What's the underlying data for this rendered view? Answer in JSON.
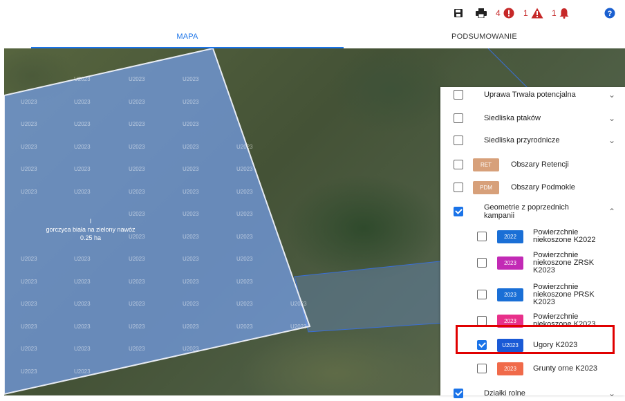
{
  "toolbar": {
    "save_icon": "save-icon",
    "print_icon": "print-icon",
    "errors_count": "4",
    "warnings_count": "1",
    "notifications_count": "1",
    "help_icon": "help-icon"
  },
  "tabs": [
    {
      "label": "MAPA",
      "active": true
    },
    {
      "label": "PODSUMOWANIE",
      "active": false
    }
  ],
  "map": {
    "grid_label": "U2023",
    "parcel_name": "gorczyca biała na zielony nawóz",
    "parcel_area": "0.25 ha",
    "parcel_marker": "I"
  },
  "panel": {
    "layers": [
      {
        "label": "Uprawa Trwała potencjalna",
        "checked": false,
        "expandable": true
      },
      {
        "label": "Siedliska ptaków",
        "checked": false,
        "expandable": true
      },
      {
        "label": "Siedliska przyrodnicze",
        "checked": false,
        "expandable": true
      },
      {
        "label": "Obszary Retencji",
        "badge": "RET",
        "checked": false
      },
      {
        "label": "Obszary Podmokle",
        "badge": "PDM",
        "checked": false
      },
      {
        "label": "Geometrie z poprzednich kampanii",
        "checked": true,
        "expanded": true
      }
    ],
    "sublayers": [
      {
        "badge": "2022",
        "label": "Powierzchnie niekoszone K2022",
        "checked": false,
        "color": "#1a6fd6"
      },
      {
        "badge": "2023",
        "label": "Powierzchnie niekoszone ZRSK K2023",
        "checked": false,
        "color": "#c22ab5"
      },
      {
        "badge": "2023",
        "label": "Powierzchnie niekoszone PRSK K2023",
        "checked": false,
        "color": "#1a6fd6"
      },
      {
        "badge": "2023",
        "label": "Powierzchnie niekoszone K2023",
        "checked": false,
        "color": "#e8308a"
      },
      {
        "badge": "U2023",
        "label": "Ugory K2023",
        "checked": true,
        "color": "#1a5ad6"
      },
      {
        "badge": "2023",
        "label": "Grunty orne K2023",
        "checked": false,
        "color": "#f06a4a"
      }
    ],
    "last_layer": {
      "label": "Działki rolne",
      "checked": true
    }
  },
  "colors": {
    "accent": "#1a73e8",
    "error": "#c62828",
    "highlight": "#e00000",
    "retention_badge": "#d7a07a"
  }
}
